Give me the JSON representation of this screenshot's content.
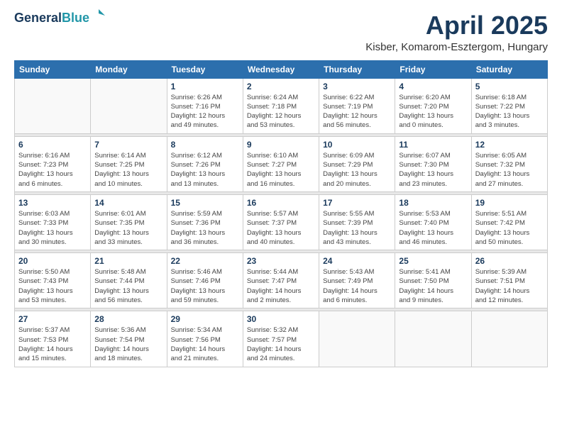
{
  "header": {
    "logo_line1": "General",
    "logo_line2": "Blue",
    "title": "April 2025",
    "subtitle": "Kisber, Komarom-Esztergom, Hungary"
  },
  "weekdays": [
    "Sunday",
    "Monday",
    "Tuesday",
    "Wednesday",
    "Thursday",
    "Friday",
    "Saturday"
  ],
  "weeks": [
    [
      {
        "day": "",
        "info": ""
      },
      {
        "day": "",
        "info": ""
      },
      {
        "day": "1",
        "info": "Sunrise: 6:26 AM\nSunset: 7:16 PM\nDaylight: 12 hours\nand 49 minutes."
      },
      {
        "day": "2",
        "info": "Sunrise: 6:24 AM\nSunset: 7:18 PM\nDaylight: 12 hours\nand 53 minutes."
      },
      {
        "day": "3",
        "info": "Sunrise: 6:22 AM\nSunset: 7:19 PM\nDaylight: 12 hours\nand 56 minutes."
      },
      {
        "day": "4",
        "info": "Sunrise: 6:20 AM\nSunset: 7:20 PM\nDaylight: 13 hours\nand 0 minutes."
      },
      {
        "day": "5",
        "info": "Sunrise: 6:18 AM\nSunset: 7:22 PM\nDaylight: 13 hours\nand 3 minutes."
      }
    ],
    [
      {
        "day": "6",
        "info": "Sunrise: 6:16 AM\nSunset: 7:23 PM\nDaylight: 13 hours\nand 6 minutes."
      },
      {
        "day": "7",
        "info": "Sunrise: 6:14 AM\nSunset: 7:25 PM\nDaylight: 13 hours\nand 10 minutes."
      },
      {
        "day": "8",
        "info": "Sunrise: 6:12 AM\nSunset: 7:26 PM\nDaylight: 13 hours\nand 13 minutes."
      },
      {
        "day": "9",
        "info": "Sunrise: 6:10 AM\nSunset: 7:27 PM\nDaylight: 13 hours\nand 16 minutes."
      },
      {
        "day": "10",
        "info": "Sunrise: 6:09 AM\nSunset: 7:29 PM\nDaylight: 13 hours\nand 20 minutes."
      },
      {
        "day": "11",
        "info": "Sunrise: 6:07 AM\nSunset: 7:30 PM\nDaylight: 13 hours\nand 23 minutes."
      },
      {
        "day": "12",
        "info": "Sunrise: 6:05 AM\nSunset: 7:32 PM\nDaylight: 13 hours\nand 27 minutes."
      }
    ],
    [
      {
        "day": "13",
        "info": "Sunrise: 6:03 AM\nSunset: 7:33 PM\nDaylight: 13 hours\nand 30 minutes."
      },
      {
        "day": "14",
        "info": "Sunrise: 6:01 AM\nSunset: 7:35 PM\nDaylight: 13 hours\nand 33 minutes."
      },
      {
        "day": "15",
        "info": "Sunrise: 5:59 AM\nSunset: 7:36 PM\nDaylight: 13 hours\nand 36 minutes."
      },
      {
        "day": "16",
        "info": "Sunrise: 5:57 AM\nSunset: 7:37 PM\nDaylight: 13 hours\nand 40 minutes."
      },
      {
        "day": "17",
        "info": "Sunrise: 5:55 AM\nSunset: 7:39 PM\nDaylight: 13 hours\nand 43 minutes."
      },
      {
        "day": "18",
        "info": "Sunrise: 5:53 AM\nSunset: 7:40 PM\nDaylight: 13 hours\nand 46 minutes."
      },
      {
        "day": "19",
        "info": "Sunrise: 5:51 AM\nSunset: 7:42 PM\nDaylight: 13 hours\nand 50 minutes."
      }
    ],
    [
      {
        "day": "20",
        "info": "Sunrise: 5:50 AM\nSunset: 7:43 PM\nDaylight: 13 hours\nand 53 minutes."
      },
      {
        "day": "21",
        "info": "Sunrise: 5:48 AM\nSunset: 7:44 PM\nDaylight: 13 hours\nand 56 minutes."
      },
      {
        "day": "22",
        "info": "Sunrise: 5:46 AM\nSunset: 7:46 PM\nDaylight: 13 hours\nand 59 minutes."
      },
      {
        "day": "23",
        "info": "Sunrise: 5:44 AM\nSunset: 7:47 PM\nDaylight: 14 hours\nand 2 minutes."
      },
      {
        "day": "24",
        "info": "Sunrise: 5:43 AM\nSunset: 7:49 PM\nDaylight: 14 hours\nand 6 minutes."
      },
      {
        "day": "25",
        "info": "Sunrise: 5:41 AM\nSunset: 7:50 PM\nDaylight: 14 hours\nand 9 minutes."
      },
      {
        "day": "26",
        "info": "Sunrise: 5:39 AM\nSunset: 7:51 PM\nDaylight: 14 hours\nand 12 minutes."
      }
    ],
    [
      {
        "day": "27",
        "info": "Sunrise: 5:37 AM\nSunset: 7:53 PM\nDaylight: 14 hours\nand 15 minutes."
      },
      {
        "day": "28",
        "info": "Sunrise: 5:36 AM\nSunset: 7:54 PM\nDaylight: 14 hours\nand 18 minutes."
      },
      {
        "day": "29",
        "info": "Sunrise: 5:34 AM\nSunset: 7:56 PM\nDaylight: 14 hours\nand 21 minutes."
      },
      {
        "day": "30",
        "info": "Sunrise: 5:32 AM\nSunset: 7:57 PM\nDaylight: 14 hours\nand 24 minutes."
      },
      {
        "day": "",
        "info": ""
      },
      {
        "day": "",
        "info": ""
      },
      {
        "day": "",
        "info": ""
      }
    ]
  ]
}
